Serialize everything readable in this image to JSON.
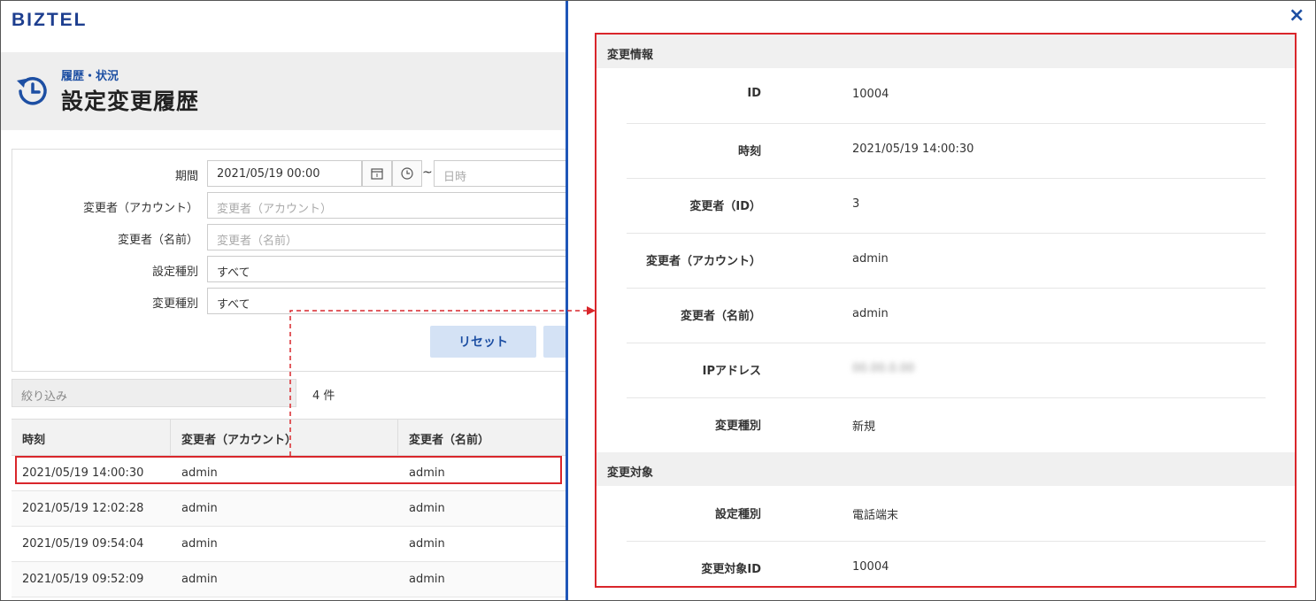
{
  "app": {
    "logo": "BIZTEL"
  },
  "page": {
    "breadcrumb": "履歴・状況",
    "title": "設定変更履歴"
  },
  "filter": {
    "period_label": "期間",
    "period_from": "2021/05/19 00:00",
    "period_tilde": "~",
    "period_to_placeholder": "日時",
    "account_label": "変更者（アカウント）",
    "account_placeholder": "変更者（アカウント）",
    "name_label": "変更者（名前）",
    "name_placeholder": "変更者（名前）",
    "setting_type_label": "設定種別",
    "setting_type_value": "すべて",
    "change_type_label": "変更種別",
    "change_type_value": "すべて",
    "reset_button": "リセット"
  },
  "list": {
    "narrow_placeholder": "絞り込み",
    "count": "4 件",
    "columns": [
      "時刻",
      "変更者（アカウント）",
      "変更者（名前）"
    ],
    "rows": [
      [
        "2021/05/19 14:00:30",
        "admin",
        "admin"
      ],
      [
        "2021/05/19 12:02:28",
        "admin",
        "admin"
      ],
      [
        "2021/05/19 09:54:04",
        "admin",
        "admin"
      ],
      [
        "2021/05/19 09:52:09",
        "admin",
        "admin"
      ]
    ]
  },
  "detail": {
    "close_icon": "×",
    "section1_title": "変更情報",
    "section1_rows": [
      {
        "label": "ID",
        "value": "10004"
      },
      {
        "label": "時刻",
        "value": "2021/05/19 14:00:30"
      },
      {
        "label": "変更者（ID）",
        "value": "3"
      },
      {
        "label": "変更者（アカウント）",
        "value": "admin"
      },
      {
        "label": "変更者（名前）",
        "value": "admin"
      },
      {
        "label": "IPアドレス",
        "value": "00.00.0.00"
      },
      {
        "label": "変更種別",
        "value": "新規"
      }
    ],
    "section2_title": "変更対象",
    "section2_rows": [
      {
        "label": "設定種別",
        "value": "電話端末"
      },
      {
        "label": "変更対象ID",
        "value": "10004"
      }
    ]
  },
  "colors": {
    "accent": "#1d4fa3",
    "highlight": "#d9262b",
    "divider": "#1f56b8"
  }
}
